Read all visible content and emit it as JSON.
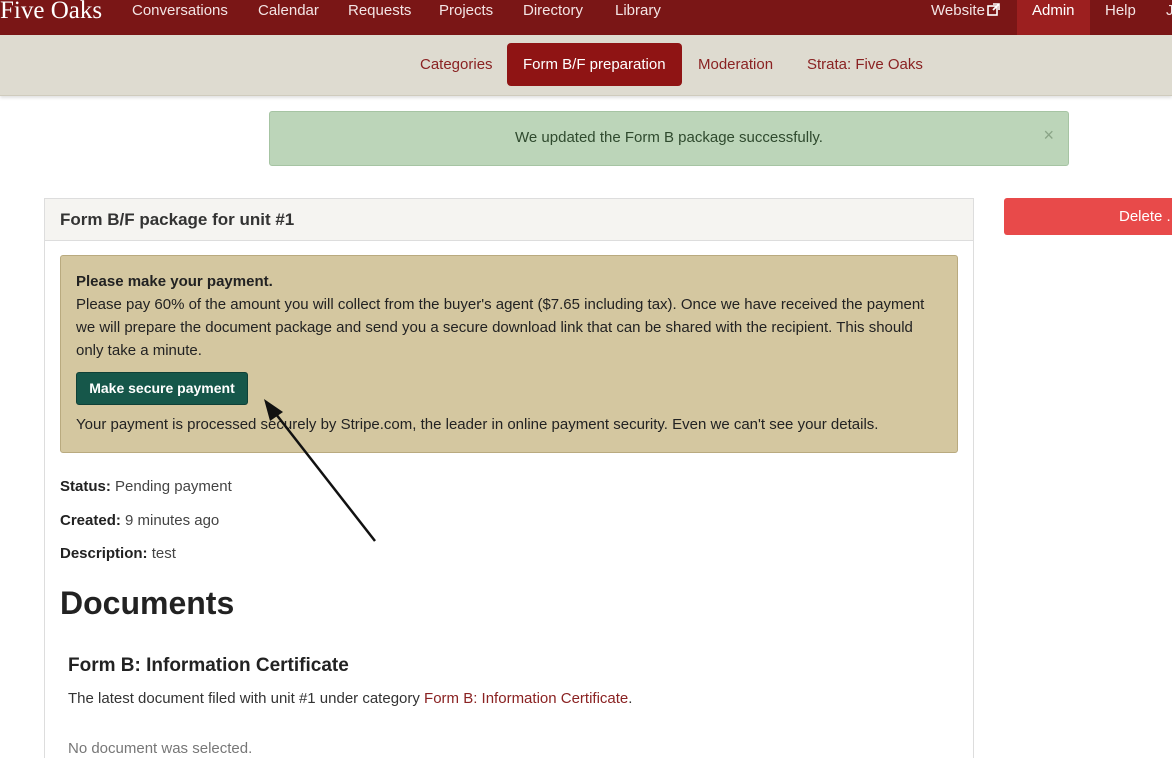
{
  "brand": "Five Oaks",
  "nav": {
    "items": [
      "Conversations",
      "Calendar",
      "Requests",
      "Projects",
      "Directory",
      "Library"
    ],
    "website": "Website",
    "admin": "Admin",
    "help": "Help",
    "user": "J"
  },
  "subnav": {
    "items": [
      "Categories",
      "Form B/F preparation",
      "Moderation",
      "Strata: Five Oaks"
    ],
    "active": "Form B/F preparation"
  },
  "alert": {
    "message": "We updated the Form B package successfully.",
    "close": "×"
  },
  "delete_button": "Delete ...",
  "panel": {
    "title": "Form B/F package for unit #1",
    "payment": {
      "heading": "Please make your payment.",
      "body": "Please pay 60% of the amount you will collect from the buyer's agent ($7.65 including tax). Once we have received the payment we will prepare the document package and send you a secure download link that can be shared with the recipient. This should only take a minute.",
      "button": "Make secure payment",
      "note": "Your payment is processed securely by Stripe.com, the leader in online payment security. Even we can't see your details."
    },
    "status_label": "Status:",
    "status_value": "Pending payment",
    "created_label": "Created:",
    "created_value": "9 minutes ago",
    "description_label": "Description:",
    "description_value": "test",
    "documents_heading": "Documents",
    "document": {
      "title": "Form B: Information Certificate",
      "desc_prefix": "The latest document filed with unit #1 under category",
      "desc_link": "Form B: Information Certificate",
      "desc_suffix": ".",
      "none_selected": "No document was selected."
    }
  },
  "colors": {
    "navbar": "#7a1616",
    "subnav": "#dedbd0",
    "alert": "#bcd5b9",
    "payment_box": "#d4c7a0",
    "pay_button": "#16574a",
    "delete_button": "#e84a4a"
  }
}
